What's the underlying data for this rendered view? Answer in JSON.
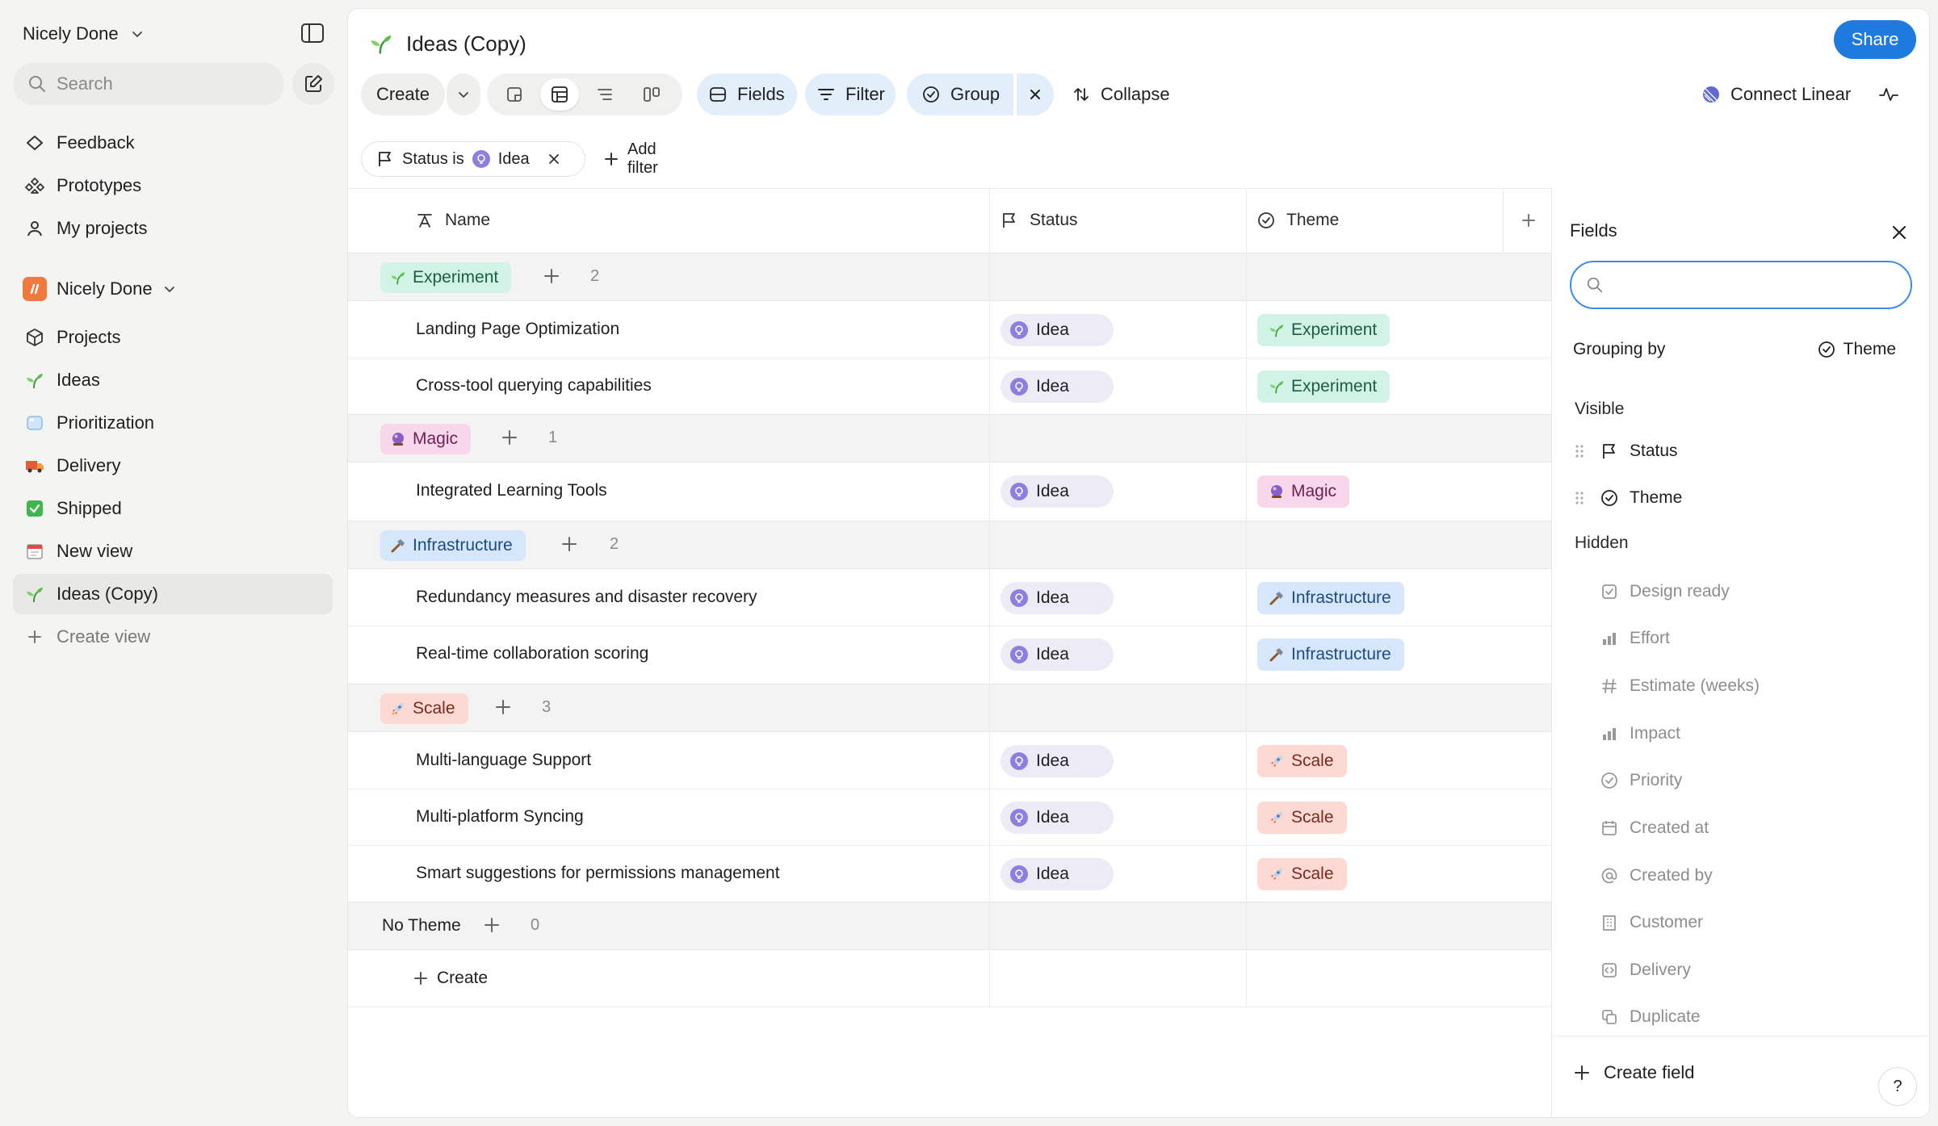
{
  "workspace": {
    "name": "Nicely Done"
  },
  "search": {
    "placeholder": "Search"
  },
  "sidebar": {
    "top_items": [
      {
        "label": "Feedback",
        "icon": "feedback-icon"
      },
      {
        "label": "Prototypes",
        "icon": "prototypes-icon"
      },
      {
        "label": "My projects",
        "icon": "user-icon"
      }
    ],
    "team": {
      "name": "Nicely Done"
    },
    "team_items": [
      {
        "label": "Projects",
        "icon": "cube-icon"
      },
      {
        "label": "Ideas",
        "icon": "seedling-icon"
      },
      {
        "label": "Prioritization",
        "icon": "ice-cube-icon"
      },
      {
        "label": "Delivery",
        "icon": "truck-icon"
      },
      {
        "label": "Shipped",
        "icon": "check-mark-icon"
      },
      {
        "label": "New view",
        "icon": "calendar-icon"
      },
      {
        "label": "Ideas (Copy)",
        "icon": "seedling-icon"
      },
      {
        "label": "Create view",
        "icon": "plus-icon"
      }
    ]
  },
  "page": {
    "title": "Ideas (Copy)",
    "share_label": "Share"
  },
  "toolbar": {
    "create": "Create",
    "fields": "Fields",
    "filter": "Filter",
    "group": "Group",
    "collapse": "Collapse",
    "connect": "Connect Linear"
  },
  "filter": {
    "field": "Status is",
    "value": "Idea",
    "add": "Add filter"
  },
  "table": {
    "columns": [
      "Name",
      "Status",
      "Theme"
    ],
    "groups": [
      {
        "label": "Experiment",
        "count": "2",
        "rows": [
          {
            "name": "Landing Page Optimization",
            "status": "Idea",
            "theme": "Experiment"
          },
          {
            "name": "Cross-tool querying capabilities",
            "status": "Idea",
            "theme": "Experiment"
          }
        ]
      },
      {
        "label": "Magic",
        "count": "1",
        "rows": [
          {
            "name": "Integrated Learning Tools",
            "status": "Idea",
            "theme": "Magic"
          }
        ]
      },
      {
        "label": "Infrastructure",
        "count": "2",
        "rows": [
          {
            "name": "Redundancy measures and disaster recovery",
            "status": "Idea",
            "theme": "Infrastructure"
          },
          {
            "name": "Real-time collaboration scoring",
            "status": "Idea",
            "theme": "Infrastructure"
          }
        ]
      },
      {
        "label": "Scale",
        "count": "3",
        "rows": [
          {
            "name": "Multi-language Support",
            "status": "Idea",
            "theme": "Scale"
          },
          {
            "name": "Multi-platform Syncing",
            "status": "Idea",
            "theme": "Scale"
          },
          {
            "name": "Smart suggestions for permissions management",
            "status": "Idea",
            "theme": "Scale"
          }
        ]
      },
      {
        "label": "No Theme",
        "count": "0",
        "rows": []
      }
    ],
    "create_label": "Create"
  },
  "fields_panel": {
    "title": "Fields",
    "grouping_label": "Grouping by",
    "grouping_value": "Theme",
    "visible_label": "Visible",
    "visible": [
      "Status",
      "Theme"
    ],
    "hidden_label": "Hidden",
    "hidden": [
      "Design ready",
      "Effort",
      "Estimate (weeks)",
      "Impact",
      "Priority",
      "Created at",
      "Created by",
      "Customer",
      "Delivery",
      "Duplicate"
    ],
    "create_field": "Create field",
    "help": "?"
  },
  "colors": {
    "accent": "#1f7ae0",
    "experiment": "#d1f3e6",
    "magic": "#f8d6ec",
    "infrastructure": "#d6e7fb",
    "scale": "#fcd9d3",
    "idea_status": "#ecebf6"
  }
}
